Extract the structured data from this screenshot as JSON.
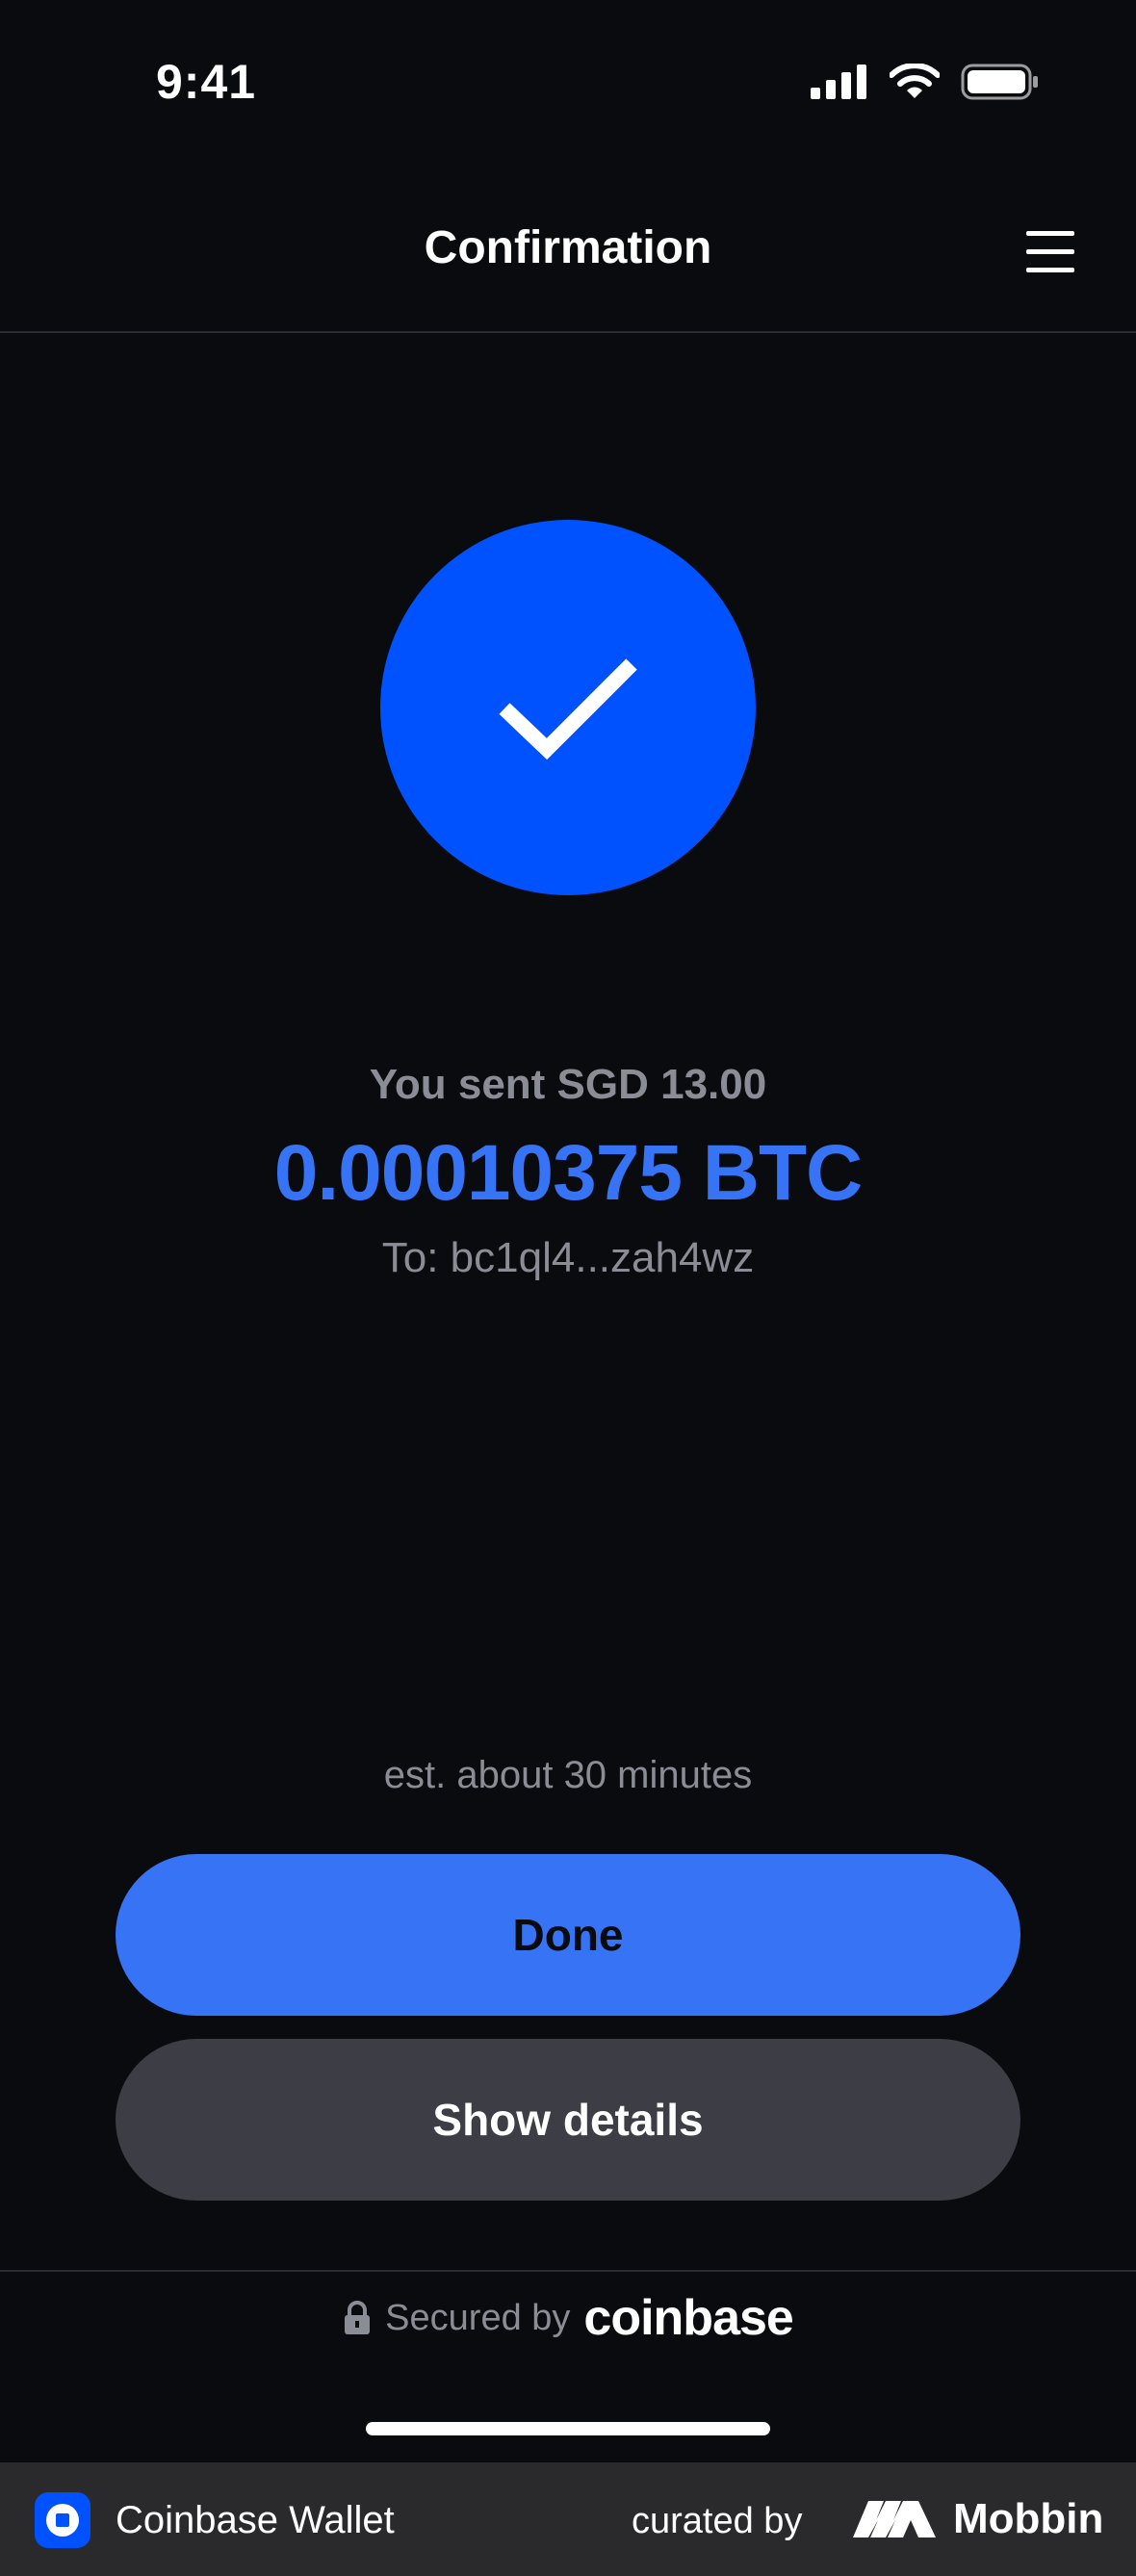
{
  "status_bar": {
    "time": "9:41"
  },
  "header": {
    "title": "Confirmation"
  },
  "confirmation": {
    "sent_label": "You sent SGD 13.00",
    "amount": "0.00010375 BTC",
    "recipient": "To: bc1ql4...zah4wz",
    "eta": "est. about 30 minutes"
  },
  "actions": {
    "done_label": "Done",
    "details_label": "Show details"
  },
  "footer": {
    "secured_text": "Secured by",
    "secured_brand": "coinbase"
  },
  "attribution": {
    "app_name": "Coinbase Wallet",
    "curated_text": "curated by",
    "curator_name": "Mobbin"
  },
  "colors": {
    "background": "#0a0b0f",
    "accent": "#3773f5",
    "success_circle": "#0052ff",
    "secondary_button": "#3c3d45",
    "muted_text": "#8a8d95"
  },
  "icons": [
    "signal-icon",
    "wifi-icon",
    "battery-icon",
    "menu-icon",
    "checkmark-icon",
    "lock-icon",
    "coinbase-wallet-icon",
    "mobbin-logo-icon"
  ]
}
